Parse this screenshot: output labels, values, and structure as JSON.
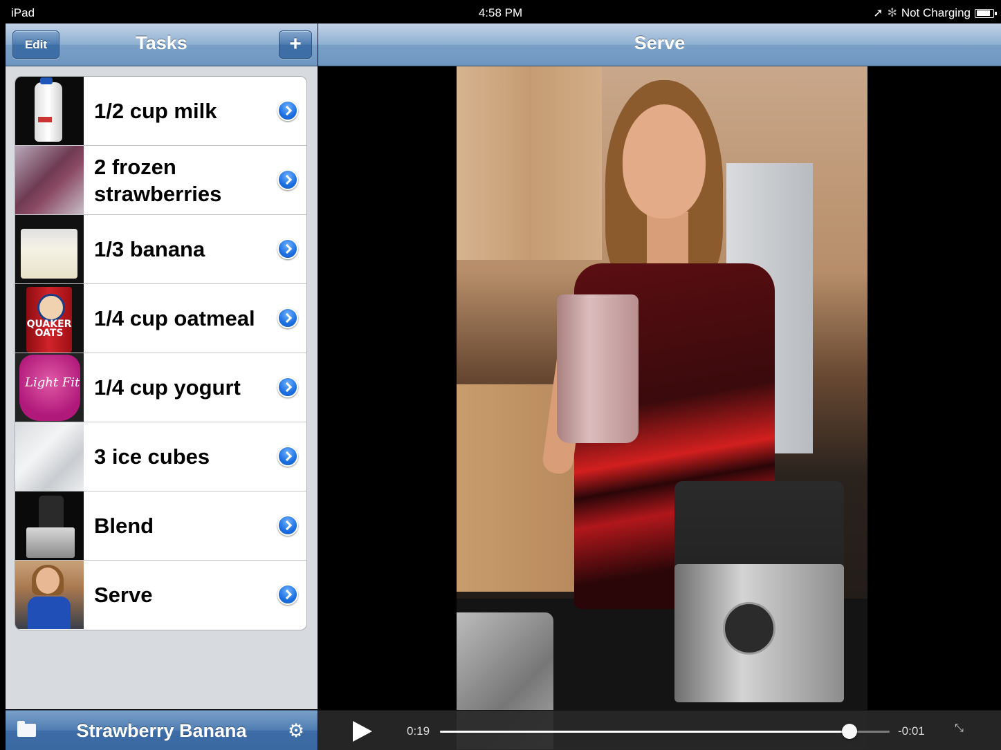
{
  "status_bar": {
    "device": "iPad",
    "time": "4:58 PM",
    "charging": "Not Charging",
    "location_icon": "location-arrow-icon",
    "bluetooth_icon": "bluetooth-icon"
  },
  "left_nav": {
    "edit_label": "Edit",
    "title": "Tasks",
    "add_label": "+"
  },
  "tasks": [
    {
      "label": "1/2 cup milk",
      "thumb": "milk-jug"
    },
    {
      "label": "2 frozen strawberries",
      "thumb": "strawberry-bag"
    },
    {
      "label": "1/3 banana",
      "thumb": "banana-bag"
    },
    {
      "label": "1/4 cup oatmeal",
      "thumb": "quaker-oats",
      "thumb_text": "QUAKER OATS"
    },
    {
      "label": "1/4 cup yogurt",
      "thumb": "yogurt-cup",
      "thumb_text": "Light Fit"
    },
    {
      "label": "3 ice cubes",
      "thumb": "ice-bag"
    },
    {
      "label": "Blend",
      "thumb": "blender"
    },
    {
      "label": "Serve",
      "thumb": "serve-photo"
    }
  ],
  "left_toolbar": {
    "list_name": "Strawberry Banana",
    "folder_icon": "folder-icon",
    "settings_icon": "gear-icon"
  },
  "right_nav": {
    "title": "Serve"
  },
  "video": {
    "current_time": "0:19",
    "remaining_time": "-0:01",
    "progress": 0.91,
    "play_icon": "play-icon",
    "fullscreen_icon": "expand-icon"
  },
  "colors": {
    "nav_blue": "#6c95c0",
    "disclosure_blue": "#1c6fe0",
    "panel_bg": "#d7dadf"
  }
}
